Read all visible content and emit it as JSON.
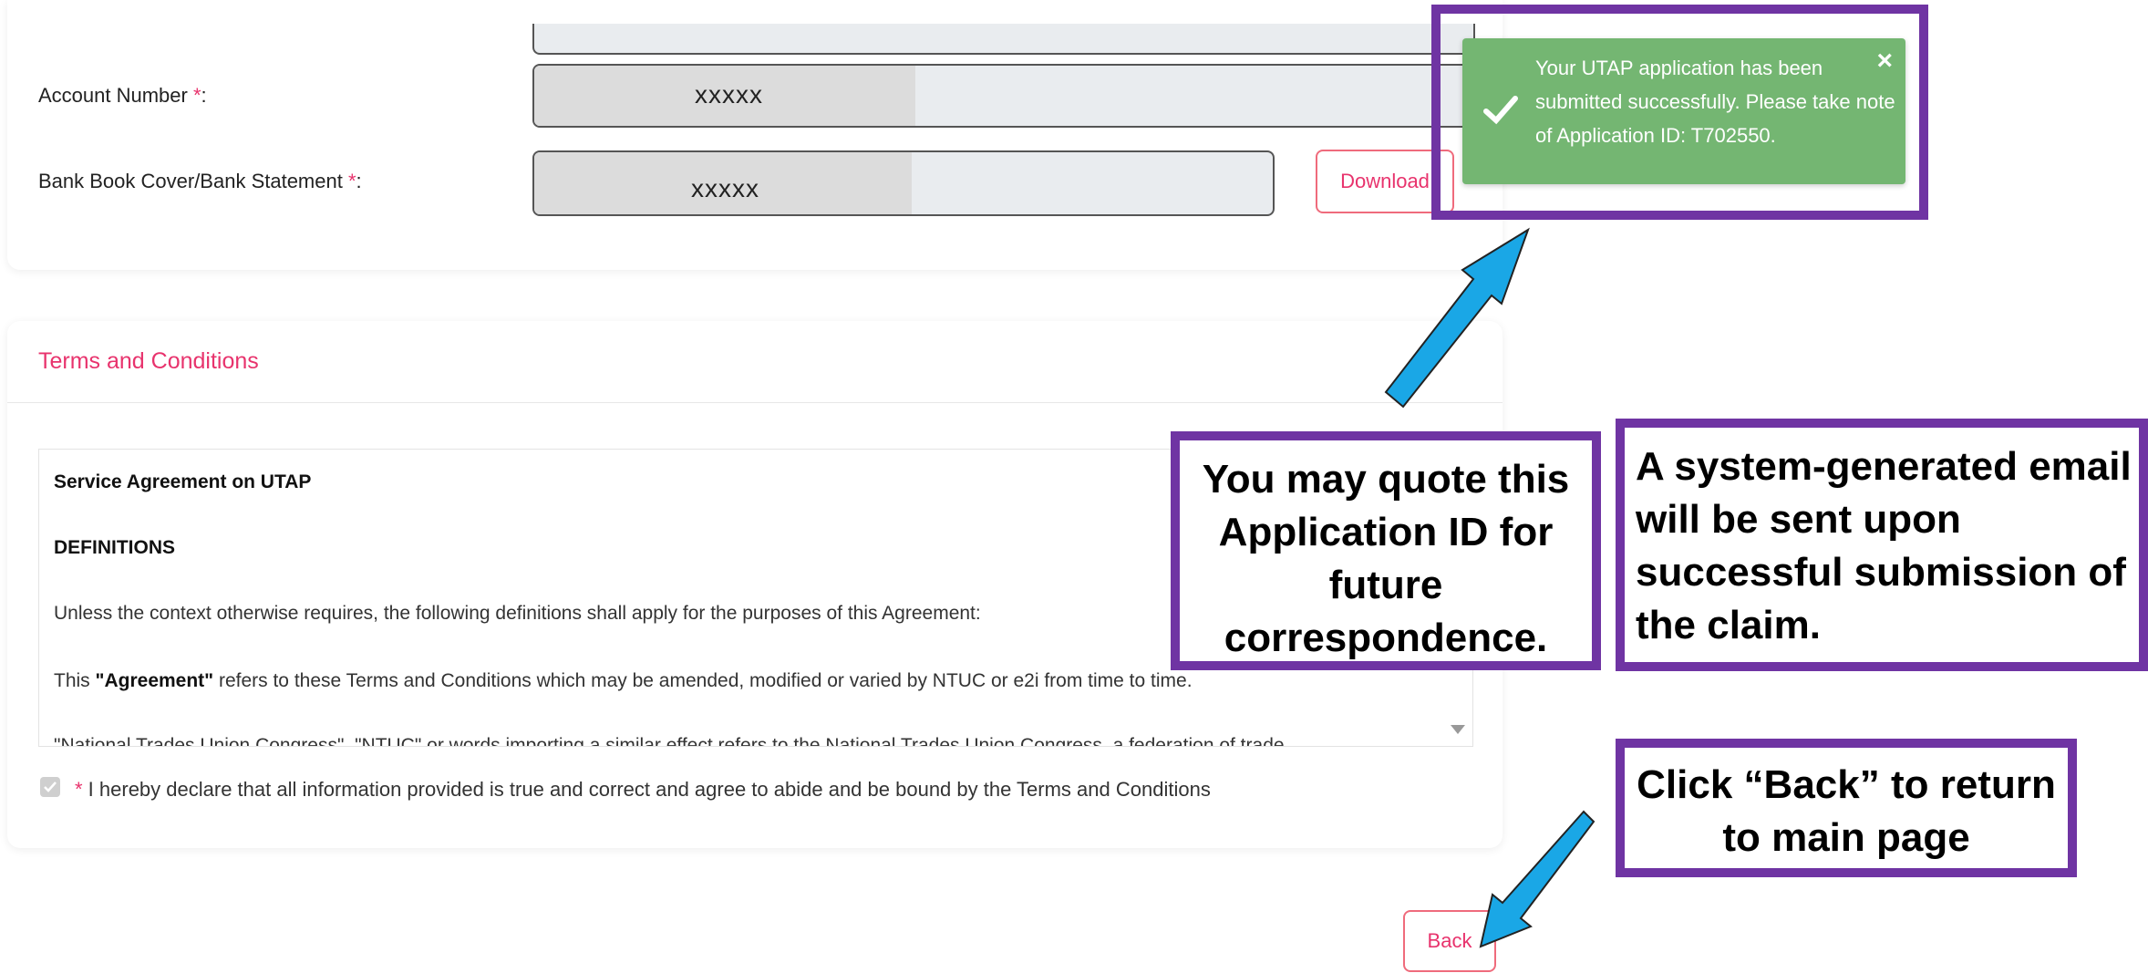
{
  "bank_section": {
    "account_number_label": "Account Number ",
    "account_number_value": "xxxxx",
    "bank_book_label": "Bank Book Cover/Bank Statement ",
    "bank_book_value": "xxxxx",
    "required_mark": "*",
    "colon": ":",
    "download_label": "Download"
  },
  "terms": {
    "title": "Terms and Conditions",
    "heading": "Service Agreement on UTAP",
    "definitions": "DEFINITIONS",
    "intro": "Unless the context otherwise requires, the following definitions shall apply for the purposes of this Agreement:",
    "agreement_prefix": "This ",
    "agreement_term": "\"Agreement\"",
    "agreement_rest": " refers to these Terms and Conditions which may be amended, modified or varied by NTUC or e2i from time to time.",
    "ntuc_line": "\"National Trades Union Congress\", \"NTUC\" or words importing a similar effect refers to the National Trades Union Congress, a federation of trade"
  },
  "declaration": {
    "required_mark": "*",
    "text": " I hereby declare that all information provided is true and correct and agree to abide and be bound by the Terms and Conditions",
    "checked": true
  },
  "back_label": "Back",
  "toast": {
    "message": "Your UTAP application has been submitted successfully. Please take note of Application ID: T702550.",
    "close_symbol": "×",
    "color": "#74b672"
  },
  "callouts": {
    "quote_id": "You may quote this Application ID for future correspondence.",
    "email": "A system-generated email will be sent upon successful submission of the claim.",
    "back": "Click “Back” to return to main page"
  },
  "colors": {
    "accent": "#e8336d",
    "callout_border": "#6f34a3",
    "arrow": "#1aa7e6"
  }
}
